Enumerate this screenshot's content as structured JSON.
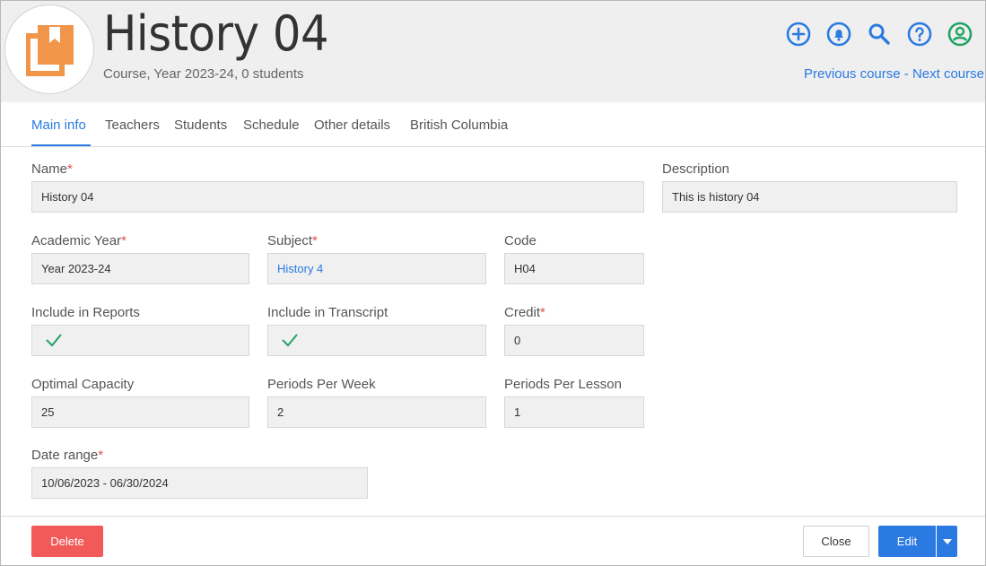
{
  "header": {
    "title": "History 04",
    "subtitle": "Course, Year 2023-24, 0 students",
    "icons": [
      "add-icon",
      "bell-icon",
      "search-icon",
      "help-icon",
      "user-icon"
    ],
    "accent_color": "#2a7ae2",
    "user_icon_color": "#1fa463",
    "logo_color": "#f0954a",
    "previous_label": "Previous course",
    "separator": " - ",
    "next_label": "Next course"
  },
  "tabs": [
    {
      "label": "Main info",
      "active": true
    },
    {
      "label": "Teachers"
    },
    {
      "label": "Students"
    },
    {
      "label": "Schedule"
    },
    {
      "label": "Other details"
    },
    {
      "label": "British Columbia"
    }
  ],
  "form": {
    "name": {
      "label": "Name",
      "required": "*",
      "value": "History 04"
    },
    "description": {
      "label": "Description",
      "value": "This is history 04"
    },
    "academic_year": {
      "label": "Academic Year",
      "required": "*",
      "value": "Year 2023-24"
    },
    "subject": {
      "label": "Subject",
      "required": "*",
      "value": "History 4"
    },
    "code": {
      "label": "Code",
      "value": "H04"
    },
    "include_reports": {
      "label": "Include in Reports",
      "checked": true
    },
    "include_transcript": {
      "label": "Include in Transcript",
      "checked": true
    },
    "credit": {
      "label": "Credit",
      "required": "*",
      "value": "0"
    },
    "optimal_capacity": {
      "label": "Optimal Capacity",
      "value": "25"
    },
    "periods_week": {
      "label": "Periods Per Week",
      "value": "2"
    },
    "periods_lesson": {
      "label": "Periods Per Lesson",
      "value": "1"
    },
    "date_range": {
      "label": "Date range",
      "required": "*",
      "value": "10/06/2023 - 06/30/2024"
    }
  },
  "footer": {
    "delete_label": "Delete",
    "close_label": "Close",
    "edit_label": "Edit",
    "delete_color": "#f25a5a",
    "check_color": "#1fa463"
  }
}
